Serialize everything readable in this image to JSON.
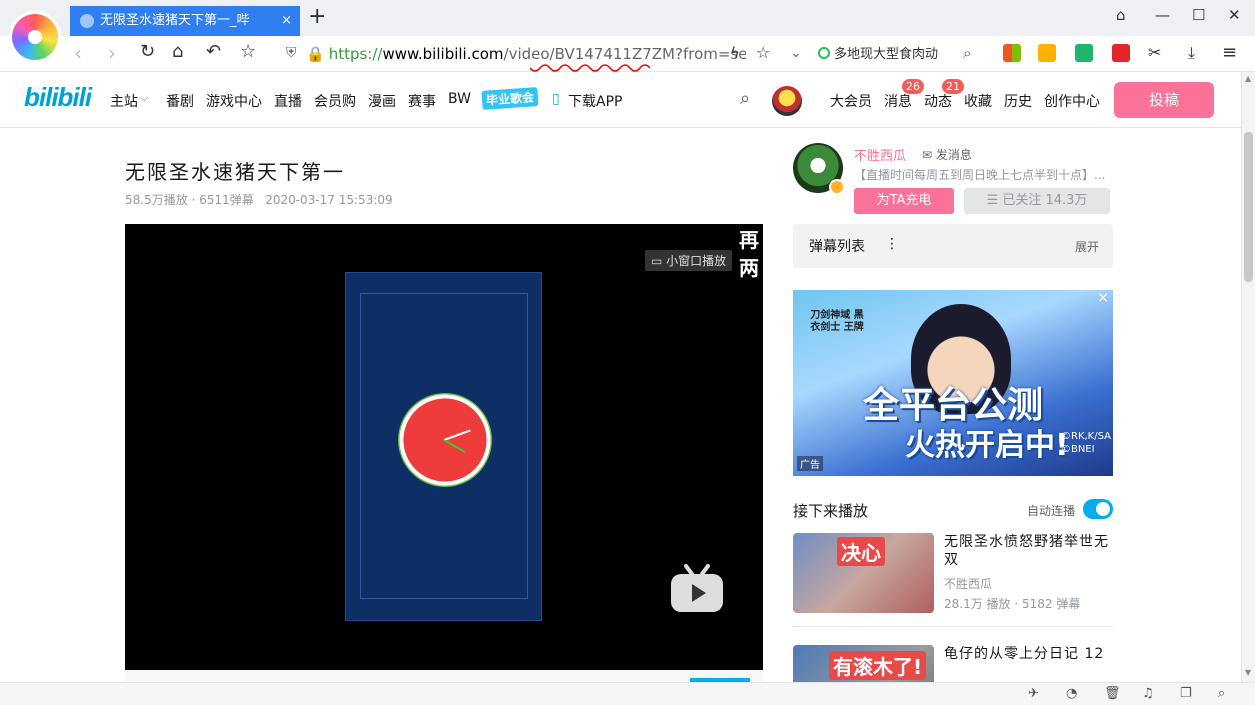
{
  "browser": {
    "tab_title": "无限圣水速猪天下第一_哔",
    "tab_close": "×",
    "new_tab": "+",
    "url_scheme": "https://",
    "url_host": "www.bilibili.com",
    "url_path": "/video/BV147411Z7ZM?from=sear",
    "search_text": "多地现大型食肉动",
    "window_controls": {
      "minimize": "—",
      "maximize": "☐",
      "close": "✕",
      "skin": "👕"
    }
  },
  "site": {
    "logo": "bilibili",
    "nav": [
      "主站",
      "番剧",
      "游戏中心",
      "直播",
      "会员购",
      "漫画",
      "赛事",
      "BW"
    ],
    "graduation": "毕业歌会",
    "download_app": "下载APP",
    "right_nav": [
      "大会员",
      "消息",
      "动态",
      "收藏",
      "历史",
      "创作中心"
    ],
    "message_badge": "26",
    "dynamic_badge": "21",
    "upload": "投稿"
  },
  "video": {
    "title": "无限圣水速猪天下第一",
    "views": "58.5万播放",
    "danmaku": "6511弹幕",
    "date": "2020-03-17 15:53:09",
    "mini_player": "小窗口播放",
    "overlay_text": "再两"
  },
  "uploader": {
    "name": "不胜西瓜",
    "send_message": "发消息",
    "description": "【直播时间每周五到周日晚上七点半到十点】...",
    "charge": "为TA充电",
    "follow": "已关注 14.3万"
  },
  "danmaku_list": {
    "title": "弹幕列表",
    "expand": "展开"
  },
  "ad": {
    "logo_text": "刀剑神域 黑衣剑士 王牌",
    "headline1": "全平台公测",
    "headline2": "火热开启中!",
    "copyright": "©RK,K/SA ©BNEI",
    "tag": "广告",
    "close": "×"
  },
  "up_next": {
    "title": "接下来播放",
    "autoplay": "自动连播",
    "items": [
      {
        "title": "无限圣水愤怒野猪举世无双",
        "author": "不胜西瓜",
        "stats": "28.1万 播放 · 5182 弹幕",
        "caption": "决心"
      },
      {
        "title": "龟仔的从零上分日记 12",
        "caption": "有滚木了!"
      }
    ]
  },
  "colors": {
    "accent_pink": "#fb7299",
    "accent_blue": "#00aeec",
    "tab_blue": "#2f7ff0"
  }
}
